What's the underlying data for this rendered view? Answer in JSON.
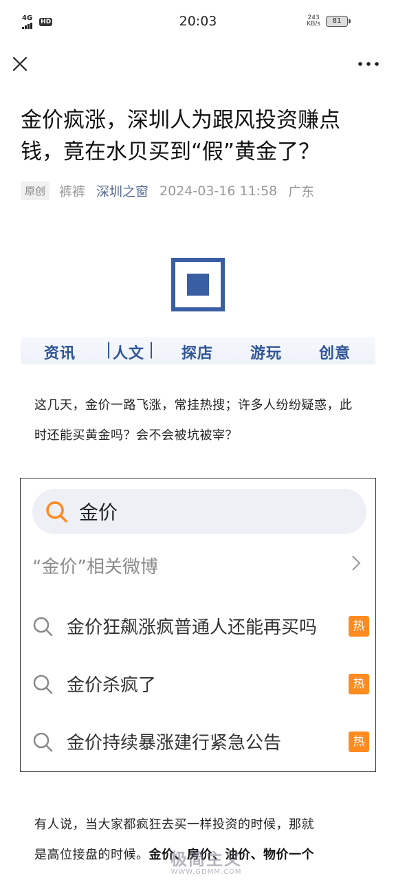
{
  "status_bar": {
    "network": "4G",
    "hd": "HD",
    "time": "20:03",
    "speed_value": "243",
    "speed_unit": "KB/s",
    "battery": "81"
  },
  "nav": {
    "close_icon": "close-icon",
    "more_icon": "more-dots-icon"
  },
  "article": {
    "title": "金价疯涨，深圳人为跟风投资赚点钱，竟在水贝买到“假”黄金了？",
    "tag": "原创",
    "author": "裤裤",
    "account": "深圳之窗",
    "date": "2024-03-16 11:58",
    "location": "广东",
    "categories": [
      "资讯",
      "人文",
      "探店",
      "游玩",
      "创意"
    ],
    "para1": "这几天，金价一路飞涨，常挂热搜；许多人纷纷疑惑，此时还能买黄金吗？会不会被坑被宰？",
    "para2_line1": "有人说，当大家都疯狂去买一样投资的时候，那就",
    "para2_line2_prefix": "是高位接盘的时候。",
    "para2_line2_bold": "金价、房价、油价、物价一个"
  },
  "search_shot": {
    "query": "金价",
    "related_label": "“金价”相关微博",
    "suggestions": [
      {
        "text": "金价狂飙涨疯普通人还能再买吗",
        "badge": "热"
      },
      {
        "text": "金价杀疯了",
        "badge": "热"
      },
      {
        "text": "金价持续暴涨建行紧急公告",
        "badge": "热"
      }
    ],
    "accent": "#ff8a1f"
  },
  "watermark": {
    "text": "极简主义",
    "url": "WWW.GDMM.COM"
  },
  "colors": {
    "link": "#576b95",
    "brand_blue": "#3a5ea3"
  }
}
